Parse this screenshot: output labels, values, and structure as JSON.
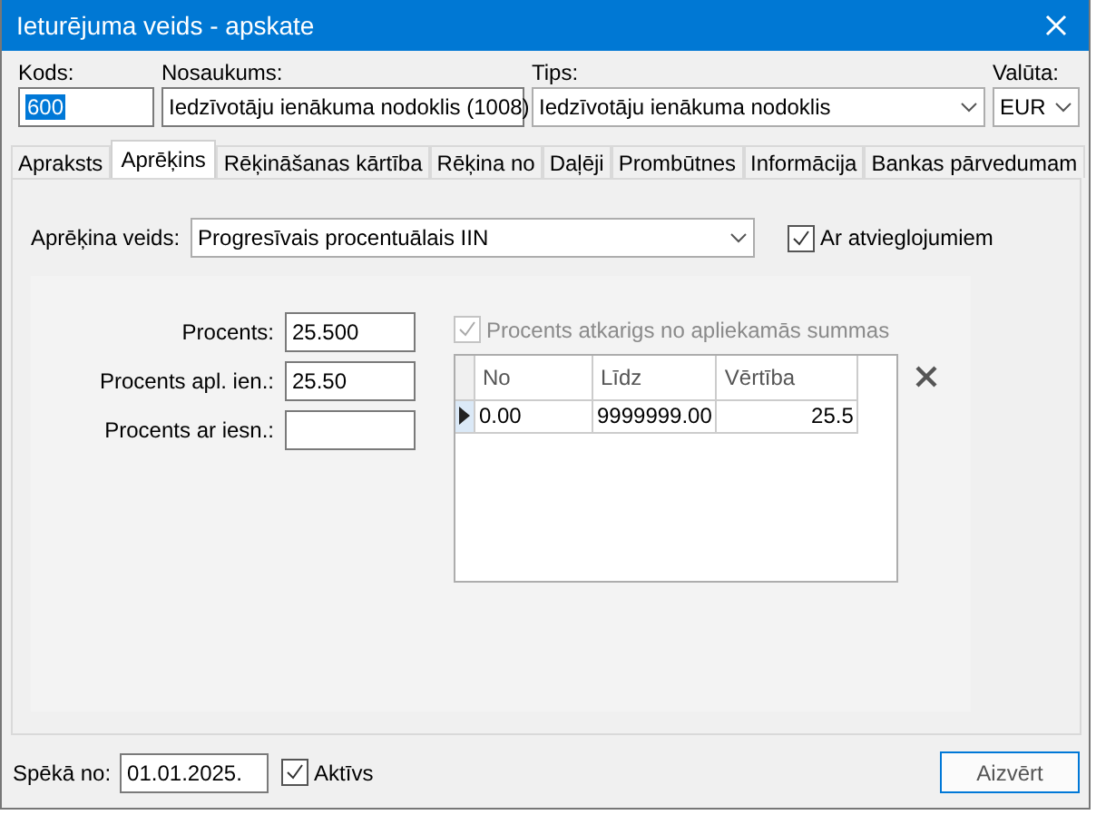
{
  "window": {
    "title": "Ieturējuma veids - apskate"
  },
  "header_fields": [
    {
      "label": "Kods:",
      "value": "600",
      "kind": "text",
      "text_selected": true
    },
    {
      "label": "Nosaukums:",
      "value": "Iedzīvotāju ienākuma nodoklis (1008)",
      "kind": "text",
      "text_selected": false
    },
    {
      "label": "Tips:",
      "value": "Iedzīvotāju ienākuma nodoklis",
      "kind": "dropdown",
      "text_selected": false
    },
    {
      "label": "Valūta:",
      "value": "EUR",
      "kind": "dropdown",
      "text_selected": false
    }
  ],
  "tabs": [
    {
      "label": "Apraksts",
      "selected": false
    },
    {
      "label": "Aprēķins",
      "selected": true
    },
    {
      "label": "Rēķināšanas kārtība",
      "selected": false
    },
    {
      "label": "Rēķina no",
      "selected": false
    },
    {
      "label": "Daļēji",
      "selected": false
    },
    {
      "label": "Prombūtnes",
      "selected": false
    },
    {
      "label": "Informācija",
      "selected": false
    },
    {
      "label": "Bankas pārvedumam",
      "selected": false
    }
  ],
  "calculation": {
    "label": "Aprēķina veids:",
    "value": "Progresīvais procentuālais IIN"
  },
  "relief_checkbox": {
    "label": "Ar atvieglojumiem",
    "checked": true,
    "disabled": false
  },
  "percent_fields": [
    {
      "label": "Procents:",
      "value": "25.500"
    },
    {
      "label": "Procents apl. ien.:",
      "value": "25.50"
    },
    {
      "label": "Procents ar iesn.:"
    }
  ],
  "dependent_checkbox": {
    "label": "Procents atkarigs no apliekamās summas",
    "checked": true,
    "disabled": true
  },
  "table": {
    "columns": [
      "No",
      "Līdz",
      "Vērtība"
    ],
    "rows": [
      {
        "cells": [
          "0.00",
          "9999999.00",
          "25.5"
        ],
        "selected": true
      }
    ]
  },
  "footer": {
    "label": "Spēkā no:",
    "value": "01.01.2025."
  },
  "active_checkbox": {
    "label": "Aktīvs",
    "checked": true,
    "disabled": false
  },
  "close_button": "Aizvērt"
}
